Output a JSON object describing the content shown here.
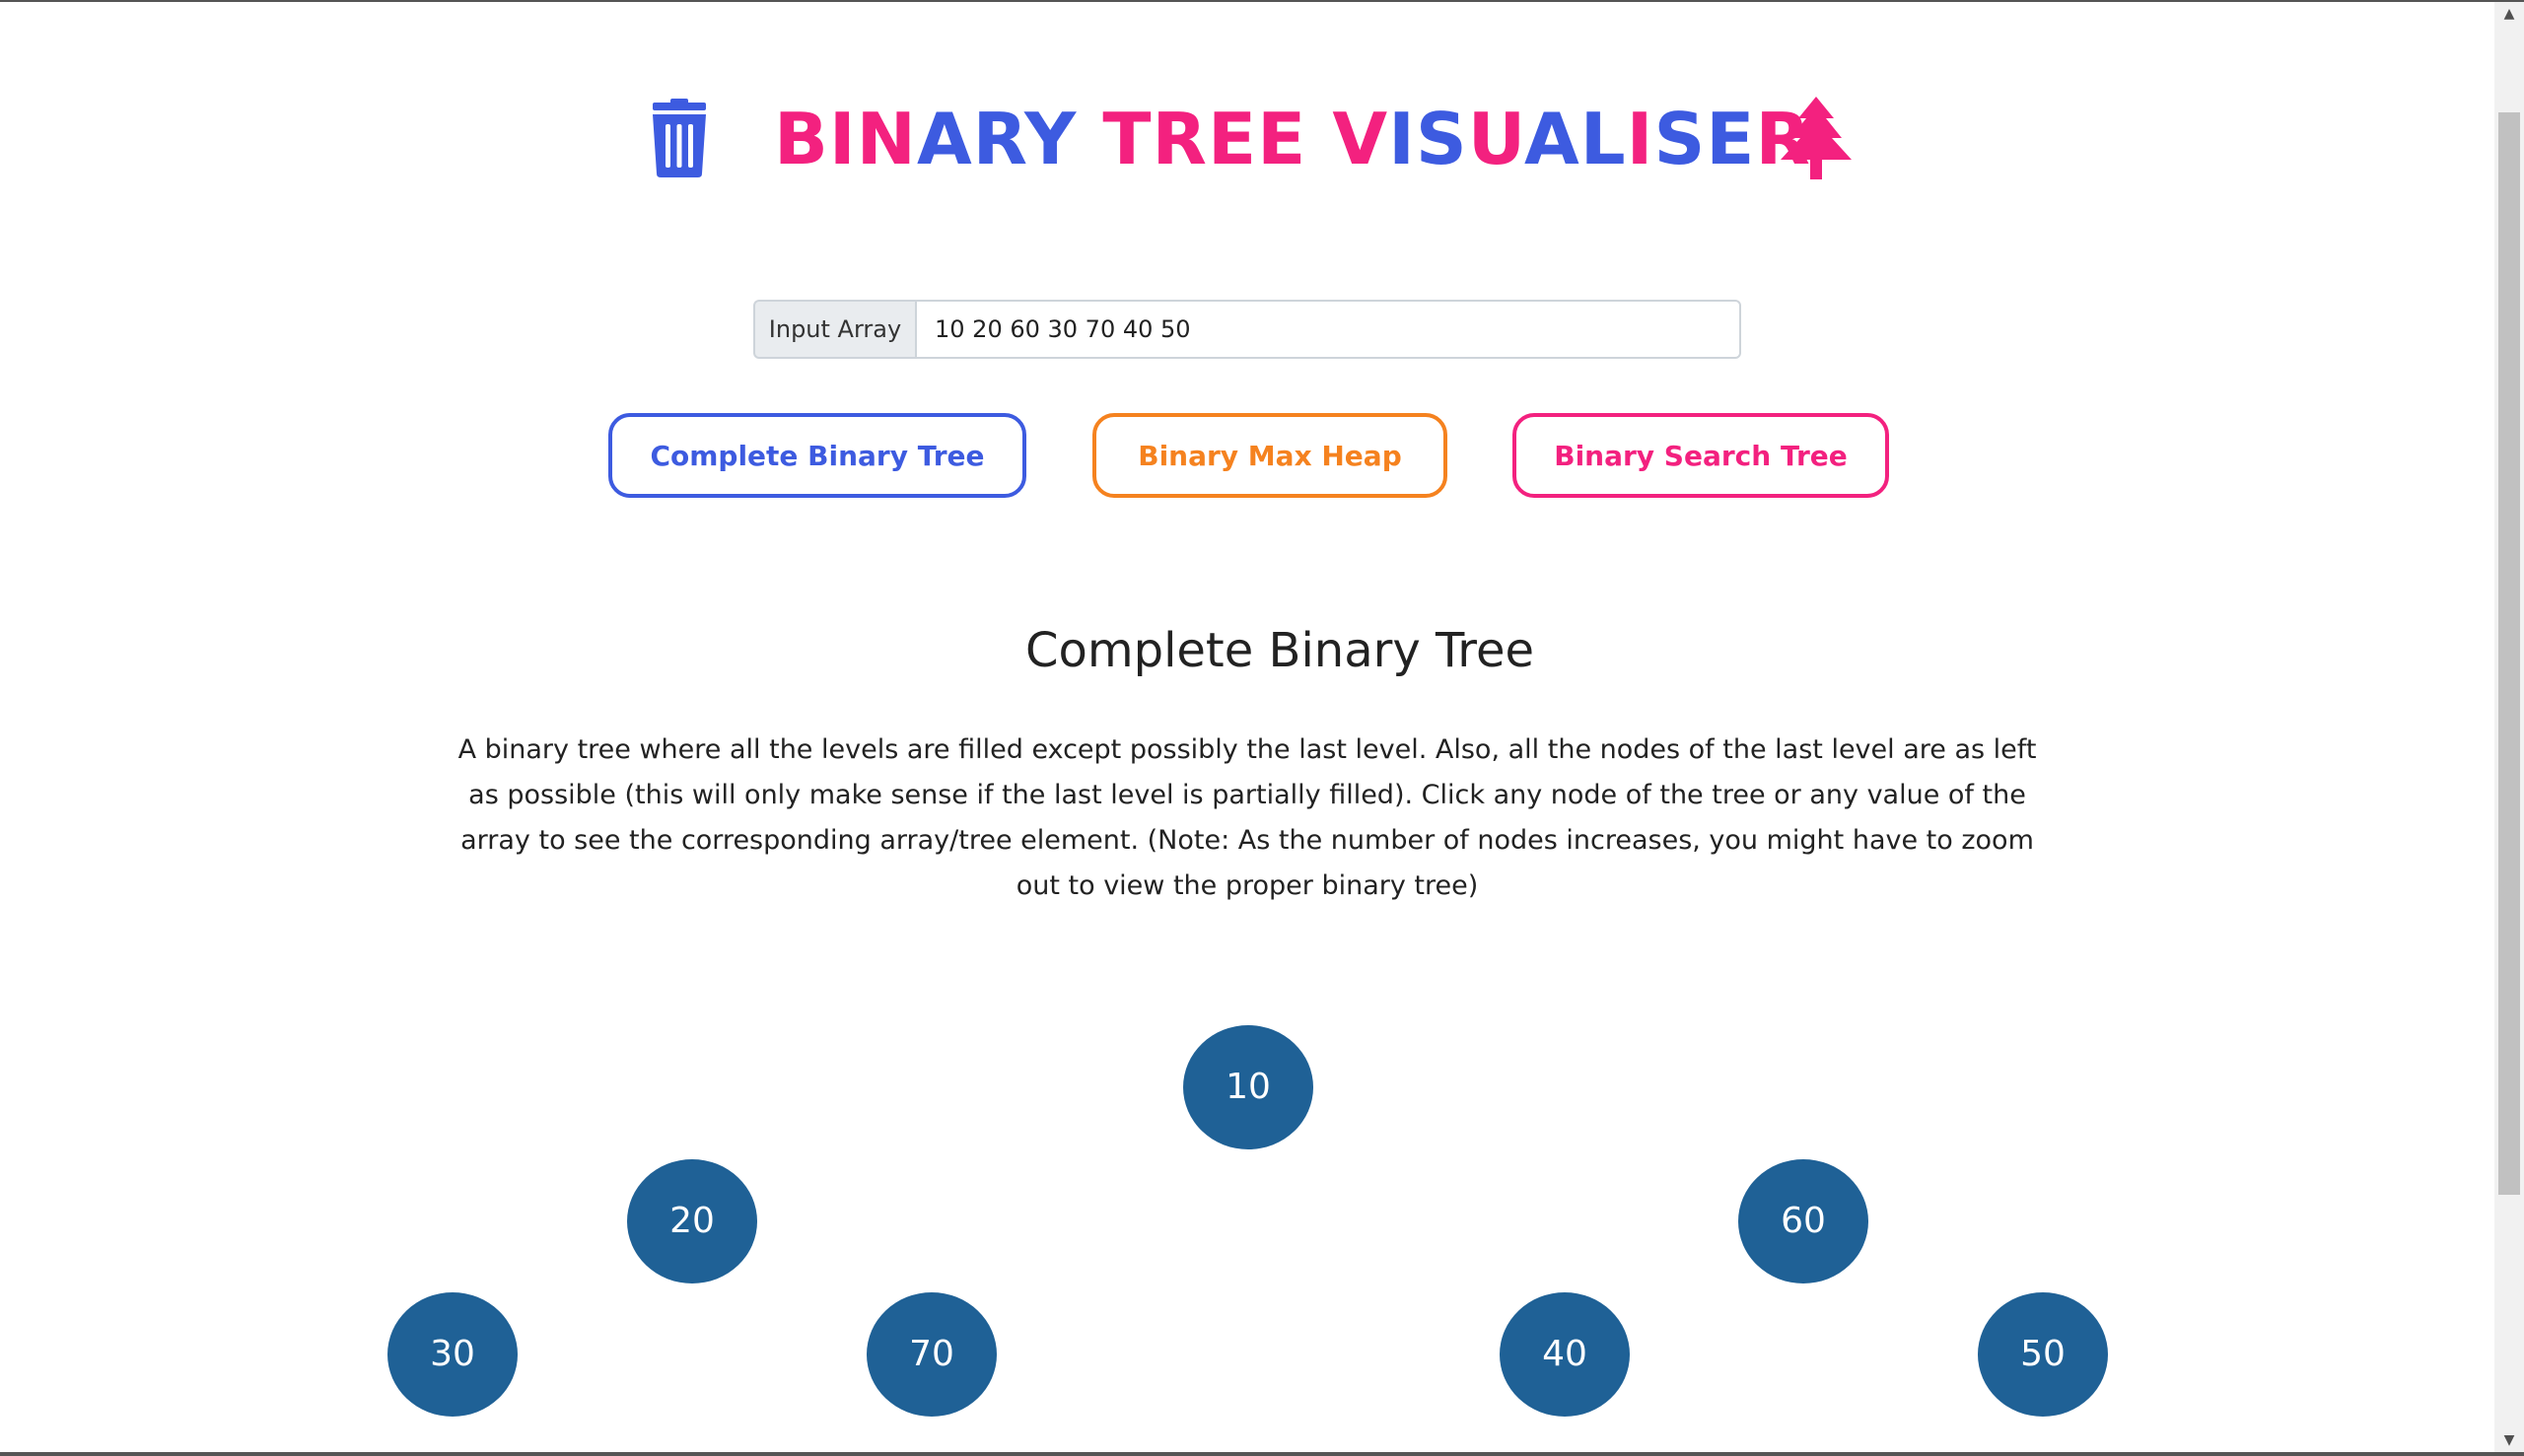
{
  "header": {
    "title_parts": [
      {
        "text": "BIN",
        "color": "#f3217f"
      },
      {
        "text": "ARY",
        "color": "#3d5be0"
      },
      {
        "text": " ",
        "color": "#3d5be0"
      },
      {
        "text": "TREE",
        "color": "#f3217f"
      },
      {
        "text": " ",
        "color": "#3d5be0"
      },
      {
        "text": "V",
        "color": "#f3217f"
      },
      {
        "text": "IS",
        "color": "#3d5be0"
      },
      {
        "text": "U",
        "color": "#f3217f"
      },
      {
        "text": "AL",
        "color": "#3d5be0"
      },
      {
        "text": "I",
        "color": "#f3217f"
      },
      {
        "text": "SE",
        "color": "#3d5be0"
      },
      {
        "text": "R",
        "color": "#f3217f"
      }
    ],
    "left_icon": "trash-icon",
    "right_icon": "tree-icon"
  },
  "input": {
    "label": "Input Array",
    "value": "10 20 60 30 70 40 50"
  },
  "buttons": {
    "complete": "Complete Binary Tree",
    "heap": "Binary Max Heap",
    "bst": "Binary Search Tree"
  },
  "section": {
    "title": "Complete Binary Tree",
    "description": "A binary tree where all the levels are filled except possibly the last level. Also, all the nodes of the last level are as left as possible (this will only make sense if the last level is partially filled). Click any node of the tree or any value of the array to see the corresponding array/tree element. (Note: As the number of nodes increases, you might have to zoom out to view the proper binary tree)"
  },
  "tree": {
    "nodes": [
      "10",
      "20",
      "60",
      "30",
      "70",
      "40",
      "50"
    ]
  },
  "colors": {
    "blue": "#3d5be0",
    "pink": "#f3217f",
    "orange": "#f5821f",
    "node": "#1f6196"
  }
}
